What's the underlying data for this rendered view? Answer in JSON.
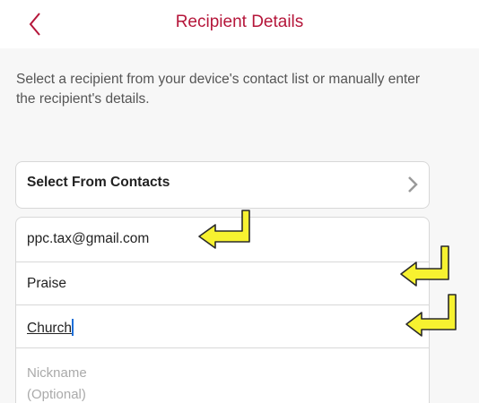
{
  "header": {
    "title": "Recipient Details",
    "back_icon": "chevron-left-icon",
    "accent_color": "#b5163a"
  },
  "intro": {
    "text": "Select a recipient from your device's contact list or manually enter the recipient's details."
  },
  "contacts": {
    "label": "Select From Contacts",
    "icon": "chevron-right-icon"
  },
  "form": {
    "email_value": "ppc.tax@gmail.com",
    "first_name_value": "Praise",
    "last_name_value": "Church",
    "nickname_placeholder": "Nickname (Optional)"
  },
  "annotations": {
    "arrow_color": "#f7f230",
    "arrow_icon": "return-arrow-icon"
  }
}
